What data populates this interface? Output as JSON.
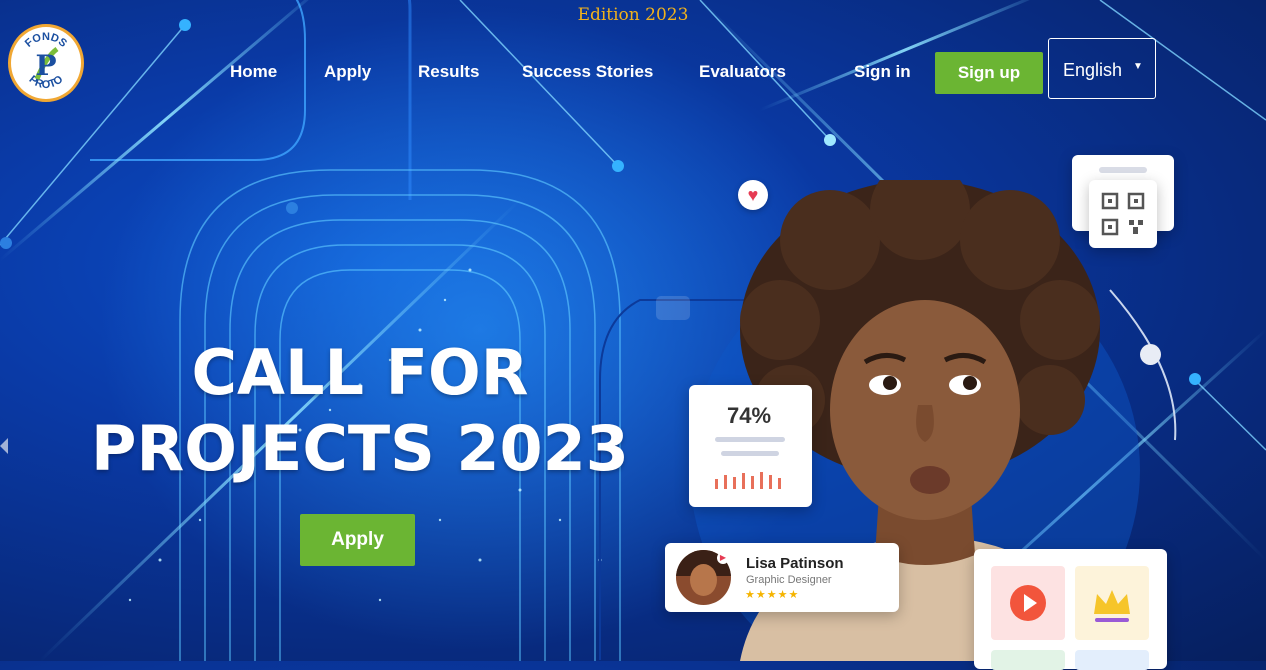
{
  "banner": {
    "edition": "Edition 2023"
  },
  "logo": {
    "text_top": "FONDS",
    "text_bottom": "PROTO",
    "letter": "P"
  },
  "nav": {
    "items": [
      {
        "id": "home",
        "label": "Home"
      },
      {
        "id": "apply",
        "label": "Apply"
      },
      {
        "id": "results",
        "label": "Results"
      },
      {
        "id": "success-stories",
        "label": "Success Stories"
      },
      {
        "id": "evaluators",
        "label": "Evaluators"
      }
    ],
    "sign_in": "Sign in",
    "sign_up": "Sign up",
    "language": "English"
  },
  "hero": {
    "title_line1": "CALL FOR",
    "title_line2": "PROJECTS 2023",
    "cta": "Apply"
  },
  "stat_card": {
    "value": "74%"
  },
  "profile_card": {
    "name": "Lisa Patinson",
    "role": "Graphic Designer",
    "stars": "★★★★★"
  },
  "colors": {
    "accent_green": "#6bb533",
    "edition_gold": "#f2b21b",
    "background": "#0a3aa6"
  },
  "icons": [
    "heart-icon",
    "qr-code-icon",
    "play-icon",
    "crown-icon",
    "chevron-down-icon",
    "arrow-left-icon"
  ]
}
